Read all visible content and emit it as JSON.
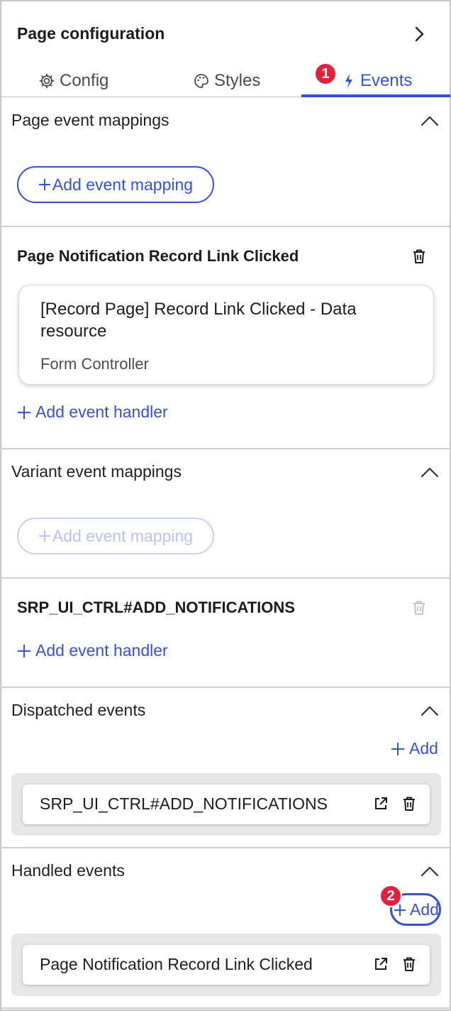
{
  "header": {
    "title": "Page configuration"
  },
  "tabs": [
    {
      "label": "Config",
      "icon": "gear-icon"
    },
    {
      "label": "Styles",
      "icon": "palette-icon"
    },
    {
      "label": "Events",
      "icon": "lightning-icon",
      "active": true
    }
  ],
  "callouts": {
    "first": "1",
    "second": "2"
  },
  "page_event_mappings": {
    "title": "Page event mappings",
    "add_label": "Add event mapping"
  },
  "page_notification": {
    "title": "Page Notification Record Link Clicked",
    "handler_title": "[Record Page] Record Link Clicked - Data resource",
    "handler_subtitle": "Form Controller",
    "add_handler_label": "Add event handler"
  },
  "variant_event_mappings": {
    "title": "Variant event mappings",
    "add_label": "Add event mapping"
  },
  "srp_block": {
    "title": "SRP_UI_CTRL#ADD_NOTIFICATIONS",
    "add_handler_label": "Add event handler"
  },
  "dispatched_events": {
    "title": "Dispatched events",
    "add_label": "Add",
    "items": [
      "SRP_UI_CTRL#ADD_NOTIFICATIONS"
    ]
  },
  "handled_events": {
    "title": "Handled events",
    "add_label": "Add",
    "items": [
      "Page Notification Record Link Clicked"
    ]
  },
  "colors": {
    "accent": "#3850d8",
    "badge": "#e2203a",
    "divider": "#cfcfcf"
  }
}
